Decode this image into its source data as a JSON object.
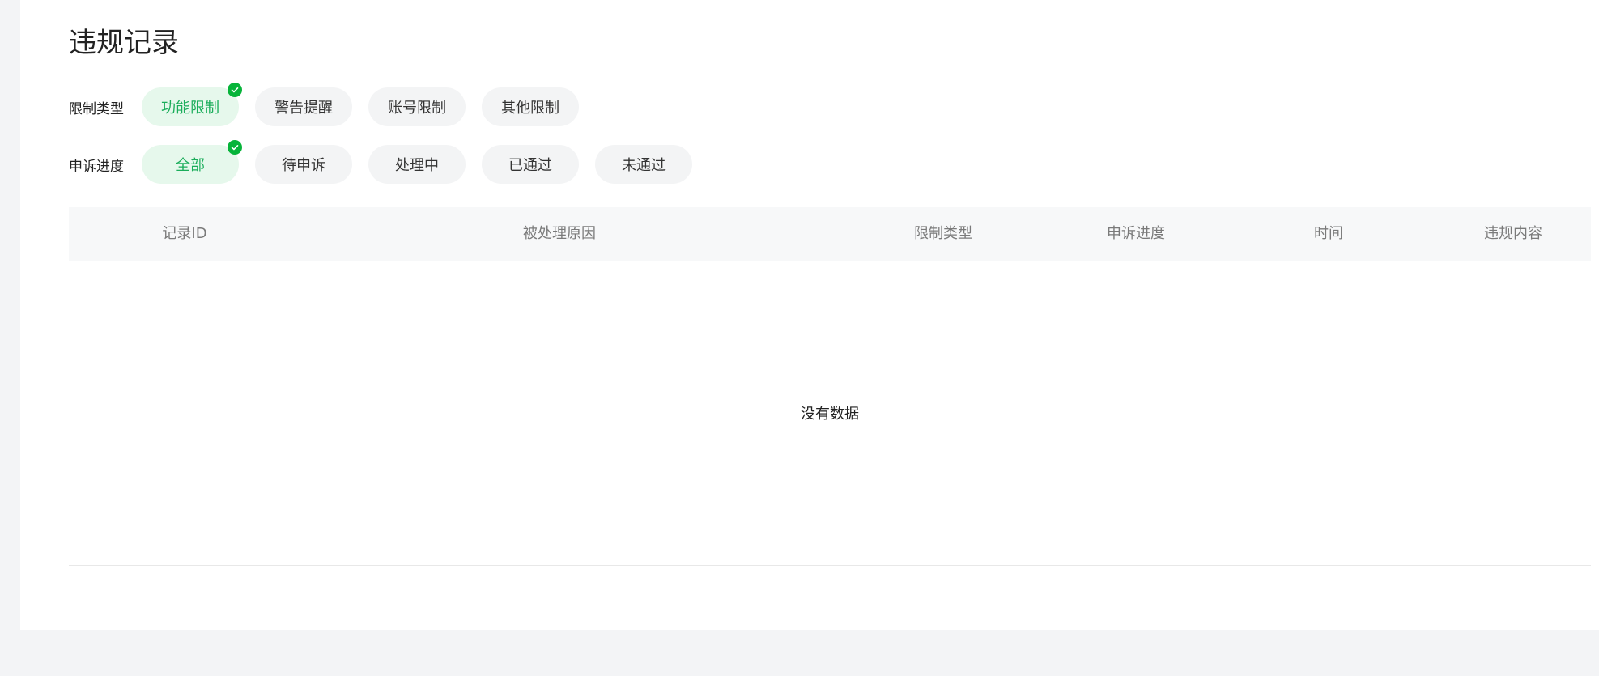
{
  "page": {
    "title": "违规记录"
  },
  "filters": {
    "restriction_type": {
      "label": "限制类型",
      "options": [
        "功能限制",
        "警告提醒",
        "账号限制",
        "其他限制"
      ],
      "selected": "功能限制"
    },
    "appeal_progress": {
      "label": "申诉进度",
      "options": [
        "全部",
        "待申诉",
        "处理中",
        "已通过",
        "未通过"
      ],
      "selected": "全部"
    }
  },
  "table": {
    "columns": [
      "记录ID",
      "被处理原因",
      "限制类型",
      "申诉进度",
      "时间",
      "违规内容"
    ],
    "rows": [],
    "empty_text": "没有数据"
  },
  "colors": {
    "accent": "#07b43a",
    "active_chip_bg": "#e6f8ec",
    "active_chip_text": "#1aad5a"
  },
  "icons": {
    "selected_badge": "check-circle-icon"
  }
}
